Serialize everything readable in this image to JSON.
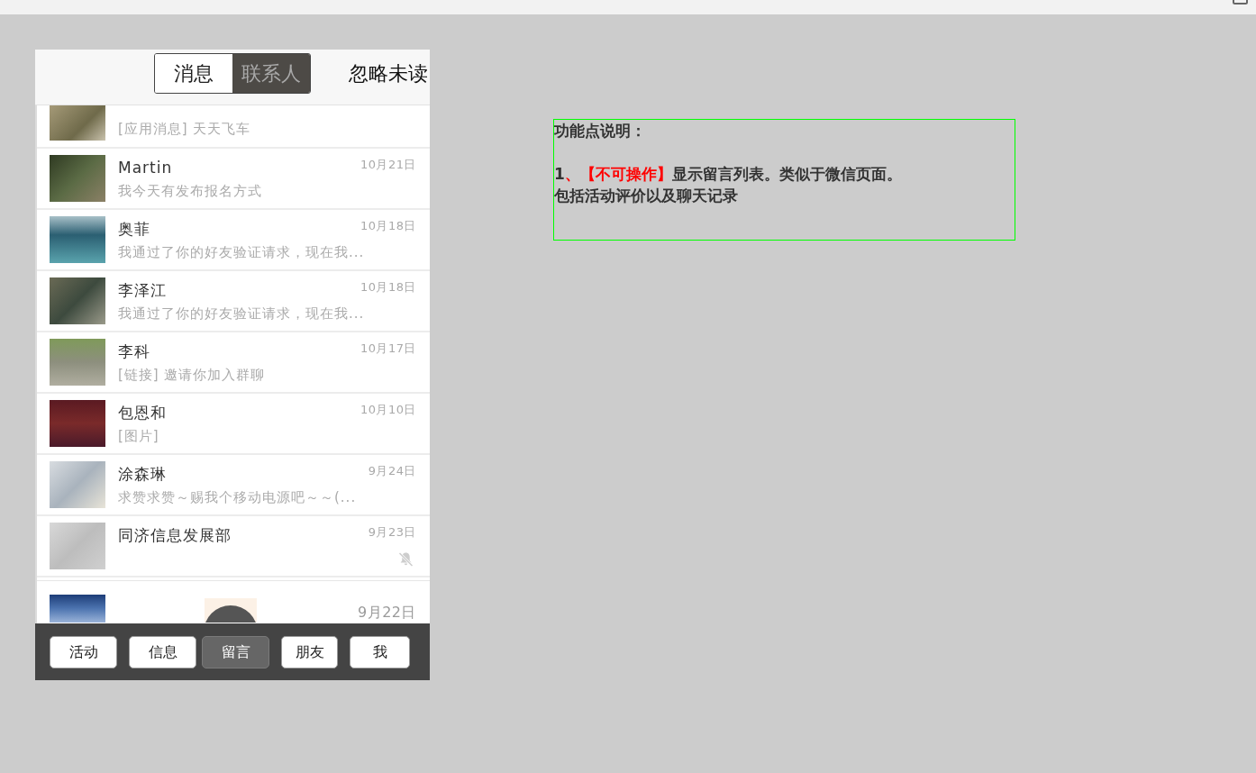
{
  "header": {
    "segments": [
      {
        "label": "消息",
        "selected": true
      },
      {
        "label": "联系人",
        "selected": false
      }
    ],
    "action": "忽略未读"
  },
  "conversations": [
    {
      "kind": "partial_top",
      "preview": "[应用消息] 天天飞车",
      "muted": false
    },
    {
      "kind": "full",
      "name": "Martin",
      "date": "10月21日",
      "preview": "我今天有发布报名方式",
      "muted": false
    },
    {
      "kind": "full",
      "name": "奥菲",
      "date": "10月18日",
      "preview": "我通过了你的好友验证请求，现在我...",
      "muted": false
    },
    {
      "kind": "full",
      "name": "李泽江",
      "date": "10月18日",
      "preview": "我通过了你的好友验证请求，现在我...",
      "muted": false
    },
    {
      "kind": "full",
      "name": "李科",
      "date": "10月17日",
      "preview": "[链接] 邀请你加入群聊",
      "muted": false
    },
    {
      "kind": "full",
      "name": "包恩和",
      "date": "10月10日",
      "preview": "[图片]",
      "muted": false
    },
    {
      "kind": "full",
      "name": "涂森琳",
      "date": "9月24日",
      "preview": "求赞求赞～赐我个移动电源吧～～(...",
      "muted": false
    },
    {
      "kind": "full",
      "name": "同济信息发展部",
      "date": "9月23日",
      "muted": true
    },
    {
      "kind": "partial_bottom",
      "date": "9月22日",
      "muted": false
    }
  ],
  "bottom_nav": [
    {
      "label": "活动",
      "selected": false
    },
    {
      "label": "信息",
      "selected": false
    },
    {
      "label": "留言",
      "selected": true
    },
    {
      "label": "朋友",
      "selected": false
    },
    {
      "label": "我",
      "selected": false
    }
  ],
  "note": {
    "title": "功能点说明：",
    "items": [
      {
        "number": "1",
        "tag": "、【不可操作】",
        "lines": [
          "显示留言列表。类似于微信页面。",
          "包括活动评价以及聊天记录"
        ]
      }
    ]
  }
}
